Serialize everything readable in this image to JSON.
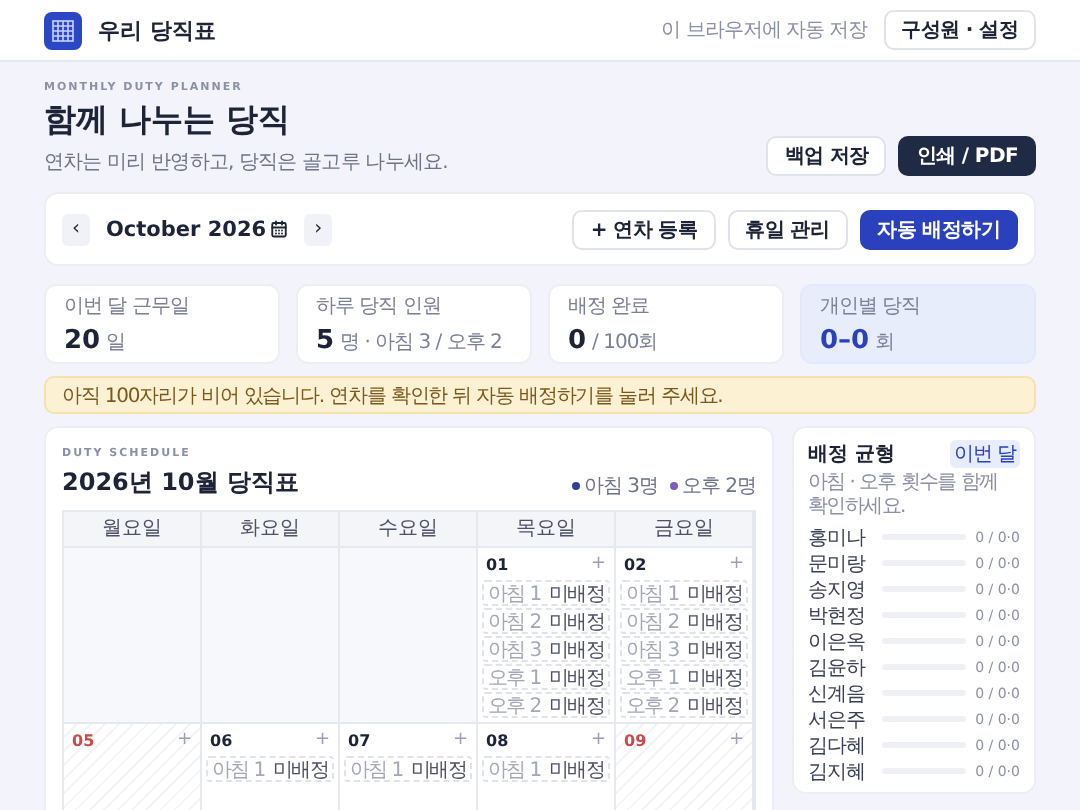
{
  "header": {
    "title": "우리 당직표",
    "autosave": "이 브라우저에 자동 저장",
    "settings_button": "구성원 · 설정"
  },
  "hero": {
    "eyebrow": "MONTHLY DUTY PLANNER",
    "title": "함께 나누는 당직",
    "subtitle": "연차는 미리 반영하고, 당직은 골고루 나누세요.",
    "buttons": [
      {
        "label": "백업 저장",
        "kind": "outline"
      },
      {
        "label": "인쇄 / PDF",
        "kind": "dark"
      }
    ]
  },
  "toolbar": {
    "prev": "‹",
    "month": "October 2026",
    "next": "›",
    "actions": [
      {
        "label": "+ 연차 등록",
        "kind": "outline"
      },
      {
        "label": "휴일 관리",
        "kind": "outline"
      },
      {
        "label": "자동 배정하기",
        "kind": "primary"
      }
    ]
  },
  "stats": [
    {
      "label": "이번 달 근무일",
      "value": "20",
      "unit": "일",
      "highlight": false
    },
    {
      "label": "하루 당직 인원",
      "value": "5",
      "unit": "명 · 아침 3 / 오후 2",
      "highlight": false
    },
    {
      "label": "배정 완료",
      "value": "0",
      "unit": "/ 100회",
      "highlight": false
    },
    {
      "label": "개인별 당직",
      "value": "0–0",
      "unit": "회",
      "highlight": true
    }
  ],
  "alert": "아직 100자리가 비어 있습니다. 연차를 확인한 뒤 자동 배정하기를 눌러 주세요.",
  "schedule": {
    "eyebrow": "DUTY SCHEDULE",
    "title": "2026년 10월 당직표",
    "legend": [
      {
        "label": "아침 3명",
        "color": "#2f3f9e"
      },
      {
        "label": "오후 2명",
        "color": "#7d5cc4"
      }
    ],
    "weekdays": [
      "월요일",
      "화요일",
      "수요일",
      "목요일",
      "금요일"
    ],
    "weeks": [
      [
        {
          "kind": "blank"
        },
        {
          "kind": "blank"
        },
        {
          "kind": "blank"
        },
        {
          "date": "01",
          "add": "+",
          "holiday": false,
          "slots": [
            {
              "label": "아침 1",
              "value": "미배정"
            },
            {
              "label": "아침 2",
              "value": "미배정"
            },
            {
              "label": "아침 3",
              "value": "미배정"
            },
            {
              "label": "오후 1",
              "value": "미배정"
            },
            {
              "label": "오후 2",
              "value": "미배정"
            }
          ]
        },
        {
          "date": "02",
          "add": "+",
          "holiday": false,
          "slots": [
            {
              "label": "아침 1",
              "value": "미배정"
            },
            {
              "label": "아침 2",
              "value": "미배정"
            },
            {
              "label": "아침 3",
              "value": "미배정"
            },
            {
              "label": "오후 1",
              "value": "미배정"
            },
            {
              "label": "오후 2",
              "value": "미배정"
            }
          ]
        }
      ],
      [
        {
          "date": "05",
          "add": "+",
          "holiday": true
        },
        {
          "date": "06",
          "add": "+",
          "holiday": false,
          "slots": [
            {
              "label": "아침 1",
              "value": "미배정"
            }
          ]
        },
        {
          "date": "07",
          "add": "+",
          "holiday": false,
          "slots": [
            {
              "label": "아침 1",
              "value": "미배정"
            }
          ]
        },
        {
          "date": "08",
          "add": "+",
          "holiday": false,
          "slots": [
            {
              "label": "아침 1",
              "value": "미배정"
            }
          ]
        },
        {
          "date": "09",
          "add": "+",
          "holiday": true
        }
      ]
    ]
  },
  "balance": {
    "title": "배정 균형",
    "badge": "이번 달",
    "subtitle": "아침 · 오후 횟수를 함께 확인하세요.",
    "members": [
      {
        "name": "홍미나",
        "level": 0,
        "reading": "0 / 0·0"
      },
      {
        "name": "문미랑",
        "level": 0,
        "reading": "0 / 0·0"
      },
      {
        "name": "송지영",
        "level": 0,
        "reading": "0 / 0·0"
      },
      {
        "name": "박현정",
        "level": 0,
        "reading": "0 / 0·0"
      },
      {
        "name": "이은옥",
        "level": 0,
        "reading": "0 / 0·0"
      },
      {
        "name": "김윤하",
        "level": 0,
        "reading": "0 / 0·0"
      },
      {
        "name": "신계음",
        "level": 0,
        "reading": "0 / 0·0"
      },
      {
        "name": "서은주",
        "level": 0,
        "reading": "0 / 0·0"
      },
      {
        "name": "김다혜",
        "level": 0,
        "reading": "0 / 0·0"
      },
      {
        "name": "김지혜",
        "level": 0,
        "reading": "0 / 0·0"
      }
    ]
  }
}
